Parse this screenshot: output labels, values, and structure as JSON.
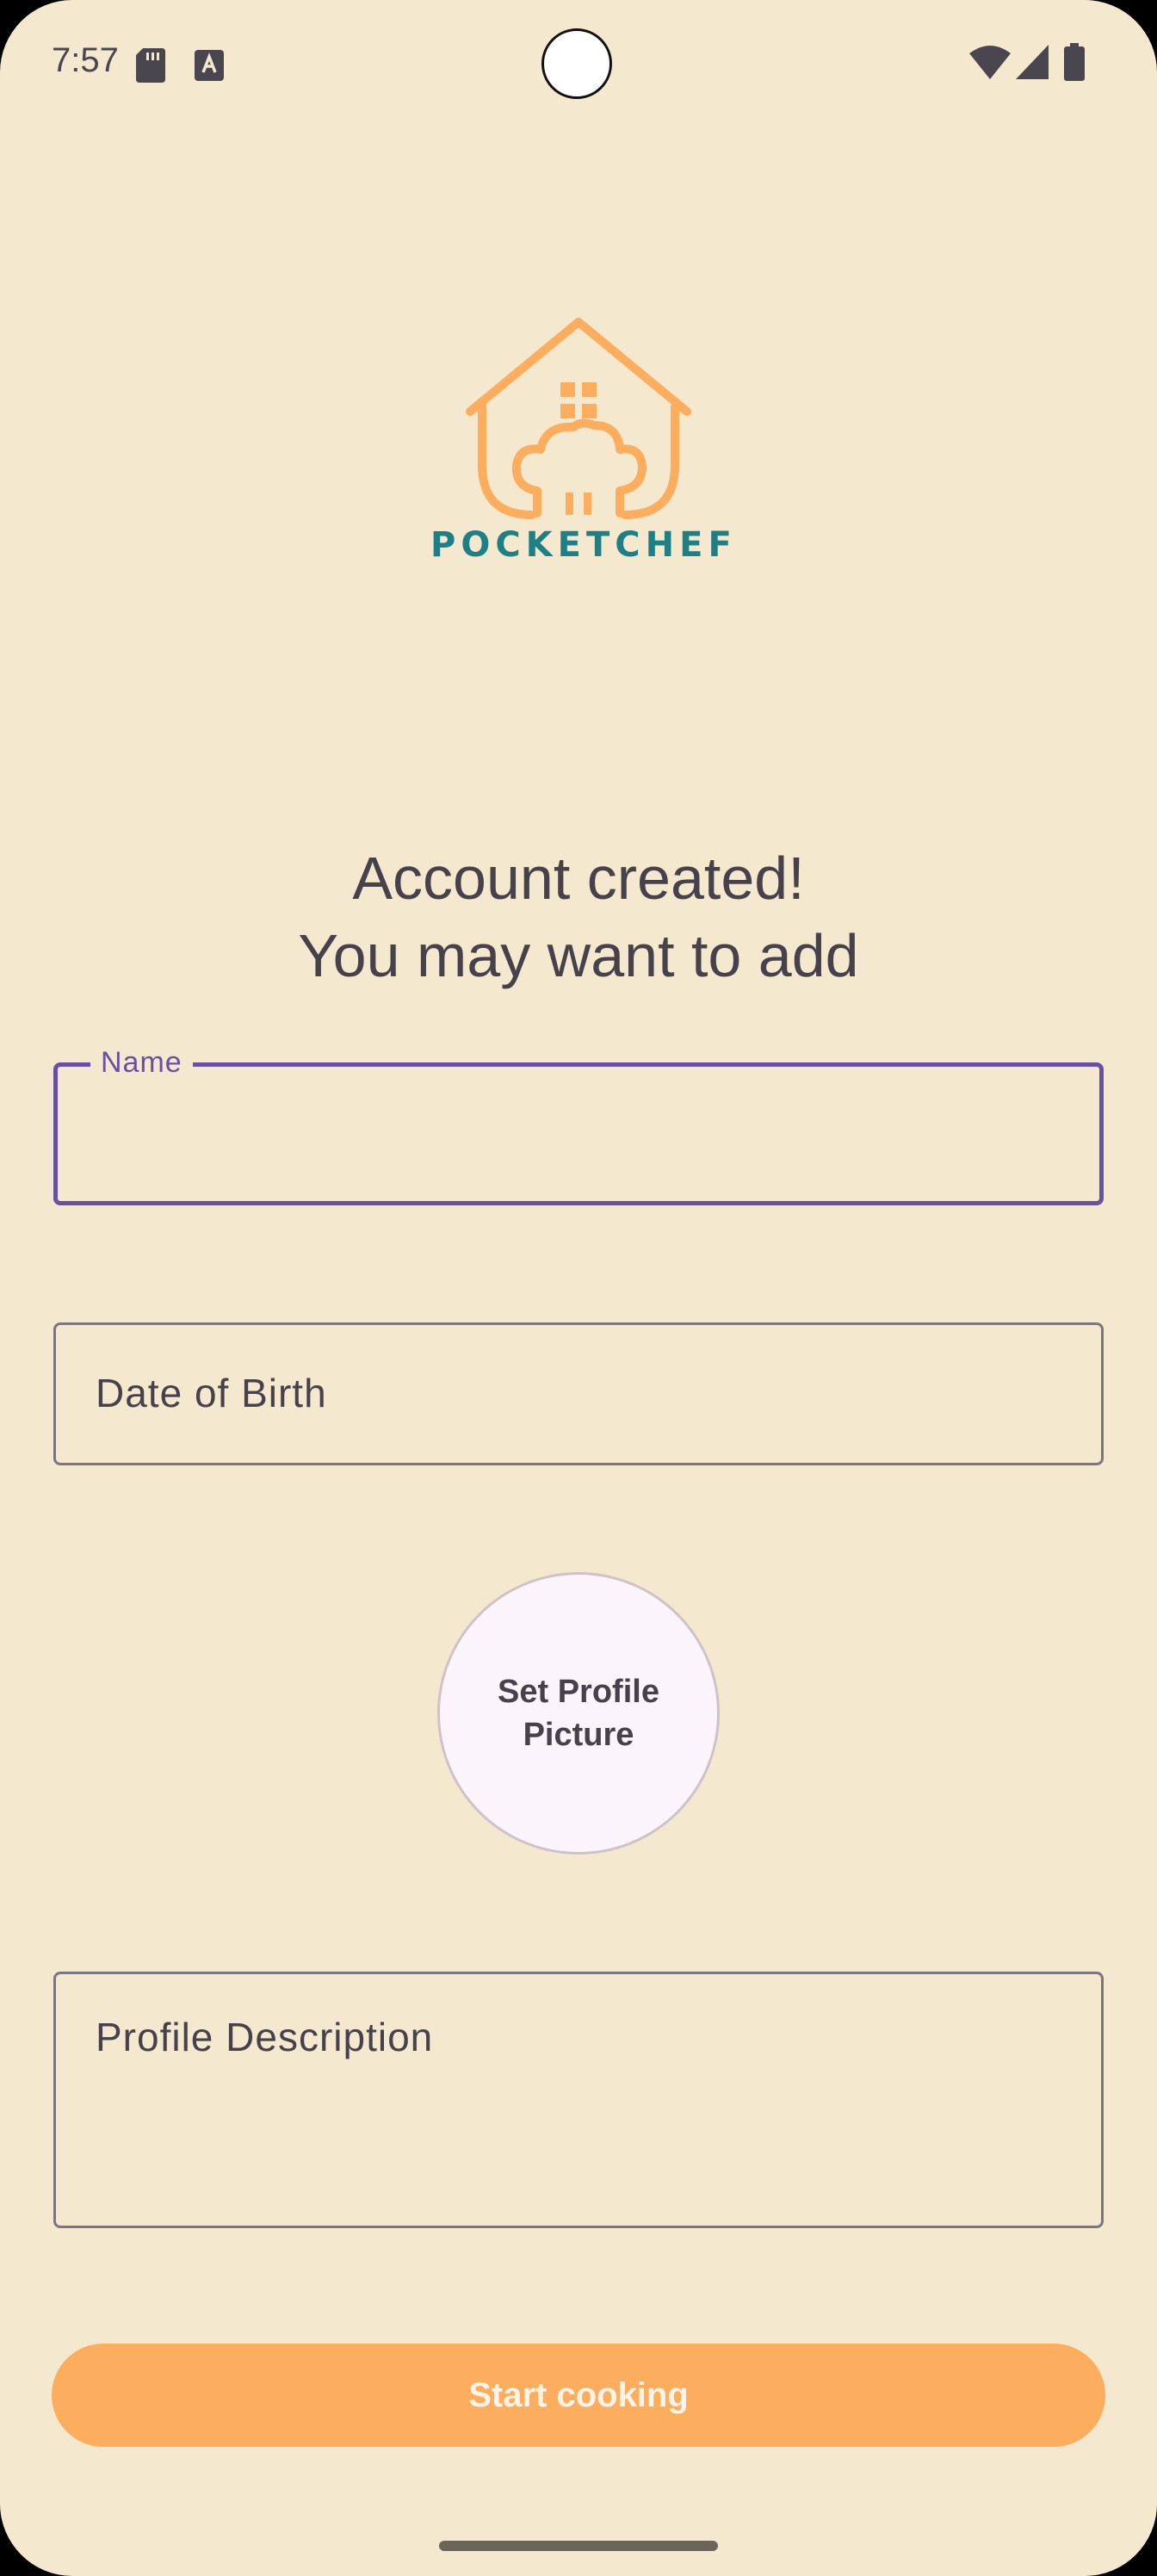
{
  "status_bar": {
    "time": "7:57",
    "icons": [
      "sd-card-icon",
      "text-a-icon",
      "wifi-icon",
      "signal-icon",
      "battery-icon"
    ]
  },
  "logo": {
    "brand_text": "POCKETCHEF",
    "icon": "chef-house-logo-icon"
  },
  "heading": {
    "line1": "Account created!",
    "line2": "You may want to add"
  },
  "form": {
    "name_label": "Name",
    "name_value": "",
    "dob_placeholder": "Date of Birth",
    "profile_picture_label_line1": "Set Profile",
    "profile_picture_label_line2": "Picture",
    "description_placeholder": "Profile Description"
  },
  "actions": {
    "start_label": "Start cooking"
  },
  "colors": {
    "background": "#f4e9cf",
    "accent_orange": "#fcad5e",
    "focus_purple": "#6a4fa6",
    "brand_teal": "#1f7f86"
  }
}
